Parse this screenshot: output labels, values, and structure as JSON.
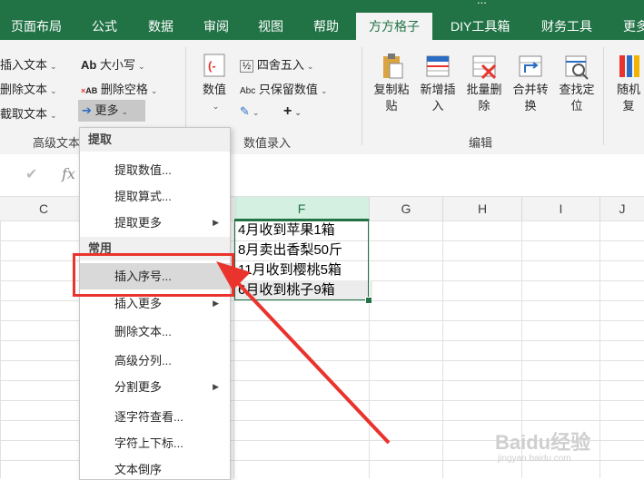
{
  "window": {
    "title_fragment": "..."
  },
  "tabs": [
    {
      "label": "页面布局"
    },
    {
      "label": "公式"
    },
    {
      "label": "数据"
    },
    {
      "label": "审阅"
    },
    {
      "label": "视图"
    },
    {
      "label": "帮助"
    },
    {
      "label": "方方格子",
      "active": true
    },
    {
      "label": "DIY工具箱"
    },
    {
      "label": "财务工具"
    },
    {
      "label": "更多"
    }
  ],
  "ribbon": {
    "text_group": {
      "items": [
        "插入文本",
        "删除文本",
        "截取文本"
      ],
      "case_label": "大小写",
      "remove_space_label": "删除空格",
      "more_label": "更多",
      "group_label": "高级文本"
    },
    "numeric_group": {
      "value_label": "数值",
      "round_label": "四舍五入",
      "keep_values_label": "只保留数值",
      "plus_label": "+",
      "group_label": "数值录入"
    },
    "edit_group": {
      "buttons": [
        {
          "label": "复制粘\n贴",
          "icon": "paste-icon"
        },
        {
          "label": "新增插\n入",
          "icon": "insert-icon"
        },
        {
          "label": "批量删\n除",
          "icon": "delete-icon"
        },
        {
          "label": "合并转\n换",
          "icon": "merge-icon"
        },
        {
          "label": "查找定\n位",
          "icon": "find-icon"
        },
        {
          "label": "随机\n复",
          "icon": "random-icon"
        }
      ],
      "group_label": "编辑"
    }
  },
  "formula_bar": {
    "check_icon": "✔",
    "fx_label": "fx"
  },
  "columns": [
    "C",
    "F",
    "G",
    "H",
    "I",
    "J"
  ],
  "cells": [
    "4月收到苹果1箱",
    "8月卖出香梨50斤",
    "11月收到樱桃5箱",
    "6月收到桃子9箱"
  ],
  "menu": {
    "sections": [
      {
        "header": "提取",
        "items": [
          {
            "label": "提取数值...",
            "submenu": false
          },
          {
            "label": "提取算式...",
            "submenu": false
          },
          {
            "label": "提取更多",
            "submenu": true
          }
        ]
      },
      {
        "header": "常用",
        "items": [
          {
            "label": "插入序号...",
            "submenu": false,
            "highlighted": true
          },
          {
            "label": "插入更多",
            "submenu": true
          },
          {
            "label": "删除文本...",
            "submenu": false
          },
          {
            "label": "高级分列...",
            "submenu": false
          },
          {
            "label": "分割更多",
            "submenu": true
          },
          {
            "label": "逐字符查看...",
            "submenu": false
          },
          {
            "label": "字符上下标...",
            "submenu": false
          },
          {
            "label": "文本倒序",
            "submenu": false
          }
        ]
      }
    ]
  },
  "watermark": {
    "text": "Baidu经验",
    "url": "jingyan.baidu.com"
  },
  "colors": {
    "accent": "#217346",
    "annotation": "#e9332c",
    "selected_col": "#d3f0e0"
  }
}
